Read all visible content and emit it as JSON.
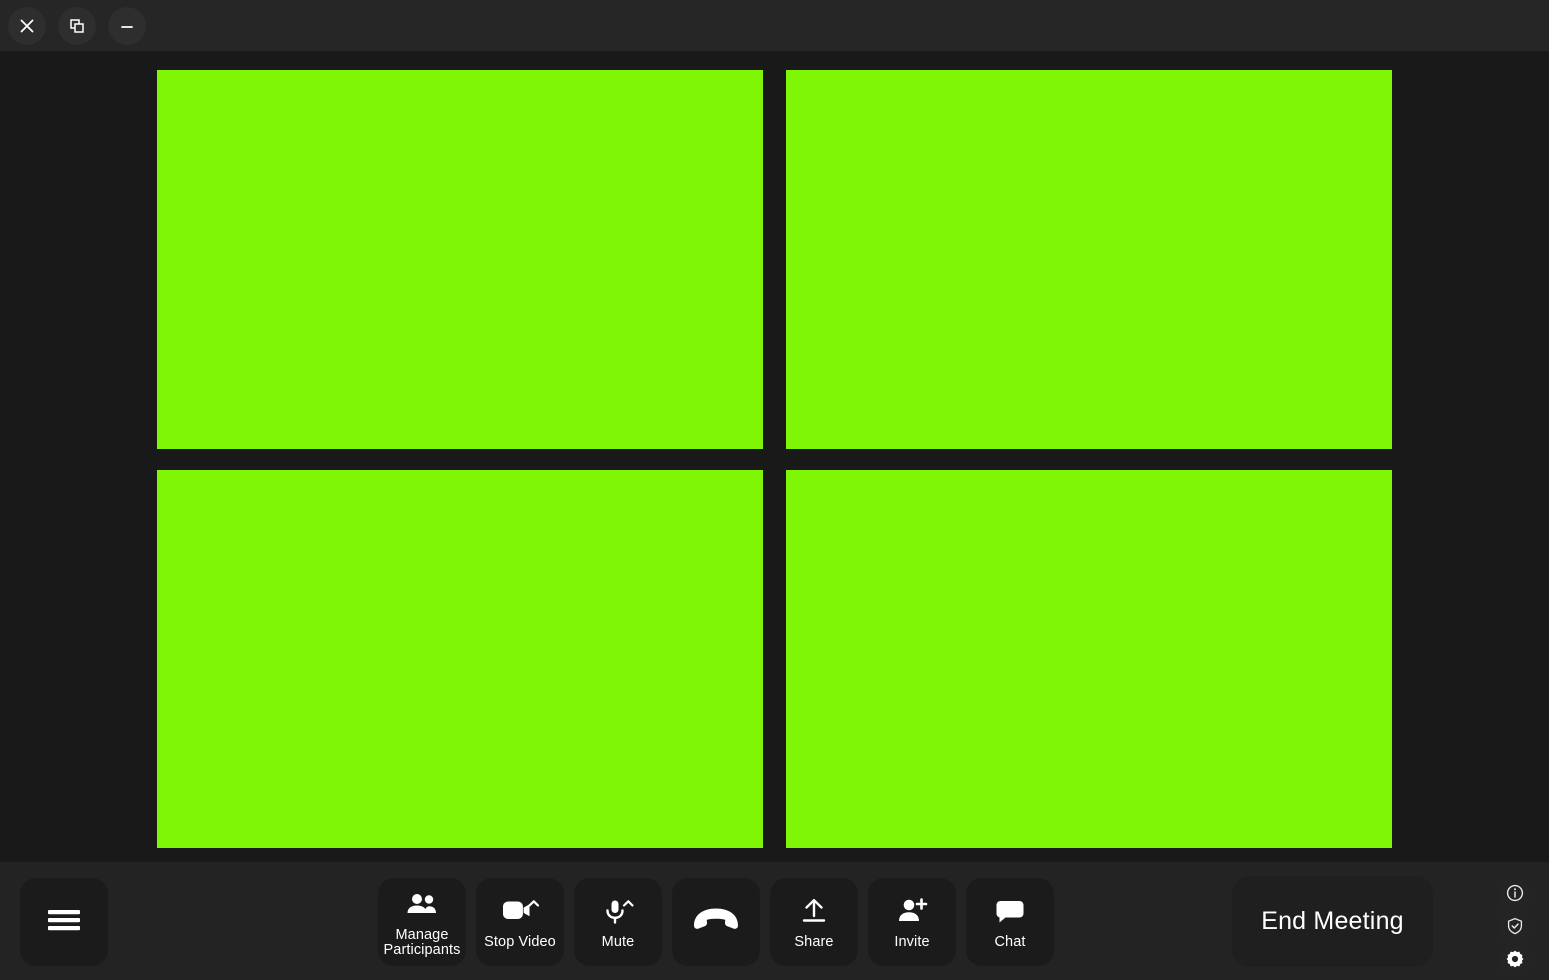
{
  "window": {
    "controls": [
      {
        "name": "close-button",
        "icon": "close-icon",
        "label": "Close"
      },
      {
        "name": "restore-button",
        "icon": "restore-window-icon",
        "label": "Restore"
      },
      {
        "name": "minimize-button",
        "icon": "minimize-icon",
        "label": "Minimize"
      }
    ]
  },
  "colors": {
    "video_tile": "#7ef605",
    "titlebar_bg": "#262626",
    "stage_bg": "#191919",
    "toolbar_bg": "#232323",
    "button_bg": "#1b1b1b",
    "text": "#ffffff"
  },
  "stage": {
    "tiles": [
      {
        "name": "video-tile-1",
        "state": "green-screen"
      },
      {
        "name": "video-tile-2",
        "state": "green-screen"
      },
      {
        "name": "video-tile-3",
        "state": "green-screen"
      },
      {
        "name": "video-tile-4",
        "state": "green-screen"
      }
    ]
  },
  "toolbar": {
    "menu_button": {
      "icon": "hamburger-menu-icon",
      "label": "Menu"
    },
    "buttons": [
      {
        "name": "manage-participants-button",
        "icon": "people-icon",
        "label": "Manage\nParticipants",
        "has_chevron": false
      },
      {
        "name": "stop-video-button",
        "icon": "video-camera-icon",
        "label": "Stop Video",
        "has_chevron": true
      },
      {
        "name": "mute-button",
        "icon": "microphone-icon",
        "label": "Mute",
        "has_chevron": true
      },
      {
        "name": "hangup-button",
        "icon": "phone-hangup-icon",
        "label": "",
        "has_chevron": false
      },
      {
        "name": "share-button",
        "icon": "share-upload-icon",
        "label": "Share",
        "has_chevron": false
      },
      {
        "name": "invite-button",
        "icon": "person-add-icon",
        "label": "Invite",
        "has_chevron": false
      },
      {
        "name": "chat-button",
        "icon": "chat-bubble-icon",
        "label": "Chat",
        "has_chevron": false
      }
    ],
    "end_meeting": {
      "label": "End Meeting"
    },
    "utilities": [
      {
        "name": "info-button",
        "icon": "info-circle-icon",
        "label": "Info"
      },
      {
        "name": "security-button",
        "icon": "shield-check-icon",
        "label": "Security"
      },
      {
        "name": "settings-button",
        "icon": "gear-icon",
        "label": "Settings"
      }
    ]
  }
}
